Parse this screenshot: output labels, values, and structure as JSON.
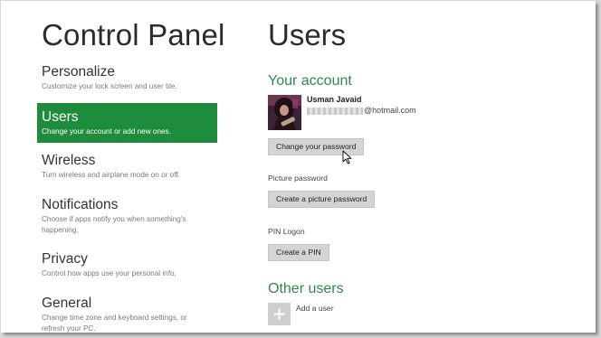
{
  "app_title": "Control Panel",
  "nav": {
    "items": [
      {
        "label": "Personalize",
        "desc": "Customize your lock screen and user tile."
      },
      {
        "label": "Users",
        "desc": "Change your account or add new ones.",
        "selected": true
      },
      {
        "label": "Wireless",
        "desc": "Turn wireless and airplane mode on or off."
      },
      {
        "label": "Notifications",
        "desc": "Choose if apps notify you when something's happening."
      },
      {
        "label": "Privacy",
        "desc": "Control how apps use your personal info."
      },
      {
        "label": "General",
        "desc": "Change time zone and keyboard settings, or refresh your PC."
      }
    ]
  },
  "page": {
    "title": "Users",
    "your_account": {
      "heading": "Your account",
      "user_name": "Usman Javaid",
      "email_domain": "@hotmail.com",
      "change_password_label": "Change your password"
    },
    "picture_password": {
      "label": "Picture password",
      "button_label": "Create a picture password"
    },
    "pin_logon": {
      "label": "PIN Logon",
      "button_label": "Create a PIN"
    },
    "other_users": {
      "heading": "Other users",
      "add_user_label": "Add a user"
    }
  },
  "colors": {
    "accent_green": "#1e8c3c",
    "section_heading_green": "#2e8b4a"
  }
}
